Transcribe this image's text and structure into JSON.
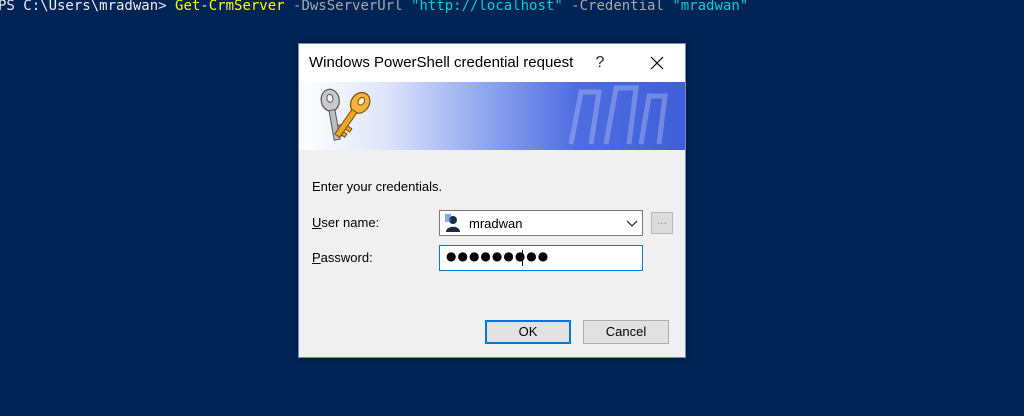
{
  "console": {
    "prompt": "PS C:\\Users\\mradwan> ",
    "command": "Get-CrmServer",
    "param1": " -DwsServerUrl ",
    "value1": "\"http://localhost\"",
    "param2": " -Credential ",
    "value2": "\"mradwan\"",
    "background_color": "#012456"
  },
  "dialog": {
    "title": "Windows PowerShell credential request",
    "help_label": "?",
    "instruction": "Enter your credentials.",
    "user_label_accel": "U",
    "user_label_rest": "ser name:",
    "user_value": "mradwan",
    "browse_label": "...",
    "password_label_accel": "P",
    "password_label_rest": "assword:",
    "password_value": "●●●●●●●●●",
    "ok_label": "OK",
    "cancel_label": "Cancel",
    "icons": {
      "banner": "keys-icon",
      "close": "close-icon",
      "user": "user-avatar-icon",
      "dropdown": "chevron-down-icon"
    }
  }
}
